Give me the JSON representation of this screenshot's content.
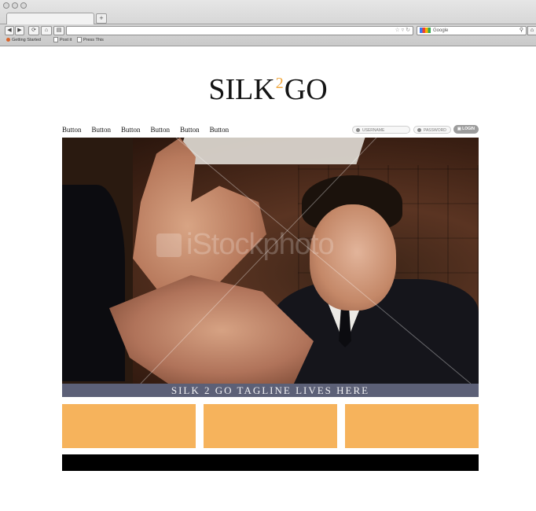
{
  "browser": {
    "newtab_glyph": "+",
    "nav_buttons": [
      "◀",
      "▶",
      "⟳",
      "⌂",
      "▤"
    ],
    "search_engine_text": "Google",
    "bookmarks": [
      "Getting Started",
      "Post it",
      "Press This"
    ]
  },
  "page": {
    "logo": {
      "part1": "SILK",
      "part2": "2",
      "part3": "GO"
    },
    "nav": [
      "Button",
      "Button",
      "Button",
      "Button",
      "Button",
      "Button"
    ],
    "login": {
      "username_placeholder": "USERNAME",
      "password_placeholder": "PASSWORD",
      "login_label": "LOGIN"
    },
    "hero_watermark": "iStockphoto",
    "tagline": "SILK 2 GO TAGLINE LIVES HERE",
    "colors": {
      "accent": "#f6b35c",
      "tagline_bg": "#5c6077",
      "footer": "#000000"
    },
    "feature_boxes": 3
  }
}
